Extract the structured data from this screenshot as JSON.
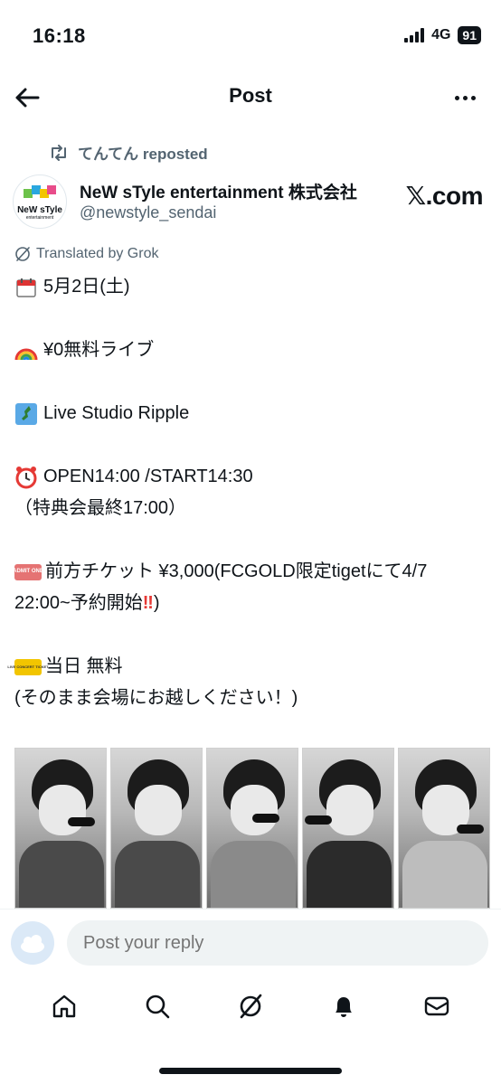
{
  "status": {
    "time": "16:18",
    "network": "4G",
    "battery": "91"
  },
  "header": {
    "title": "Post",
    "back_icon": "arrow-left-icon",
    "more_icon": "more-horizontal-icon"
  },
  "repost": {
    "text": "てんてん reposted",
    "icon": "repost-icon"
  },
  "author": {
    "name": "NeW sTyle entertainment 株式会社",
    "handle": "@newstyle_sendai",
    "avatar_text": "NeW sTyle",
    "avatar_sub": "entertainment"
  },
  "watermark": "𝕏.com",
  "translated": "Translated by Grok",
  "post": {
    "line1": "5月2日(土)",
    "line2": "¥0無料ライブ",
    "line3": "Live Studio Ripple",
    "line4": "OPEN14:00 /START14:30",
    "line5": "（特典会最終17:00）",
    "line6": "前方チケット ¥3,000(FCGOLD限定tigetにて4/7",
    "line7": "22:00~予約開始",
    "line7_end": ")",
    "line8": "当日 無料",
    "line9": "(そのまま会場にお越しください！)",
    "ticket1_text": "ADMIT ONE",
    "ticket2_text": "LIVE CONCERT TICKET"
  },
  "media": {
    "photo_count": 5
  },
  "reply": {
    "placeholder": "Post your reply"
  },
  "tabs": [
    "home-icon",
    "search-icon",
    "grok-icon",
    "notifications-icon",
    "messages-icon"
  ],
  "colors": {
    "text": "#0f1419",
    "secondary": "#536471",
    "input_bg": "#eff3f4",
    "accent": "#1d9bf0"
  }
}
